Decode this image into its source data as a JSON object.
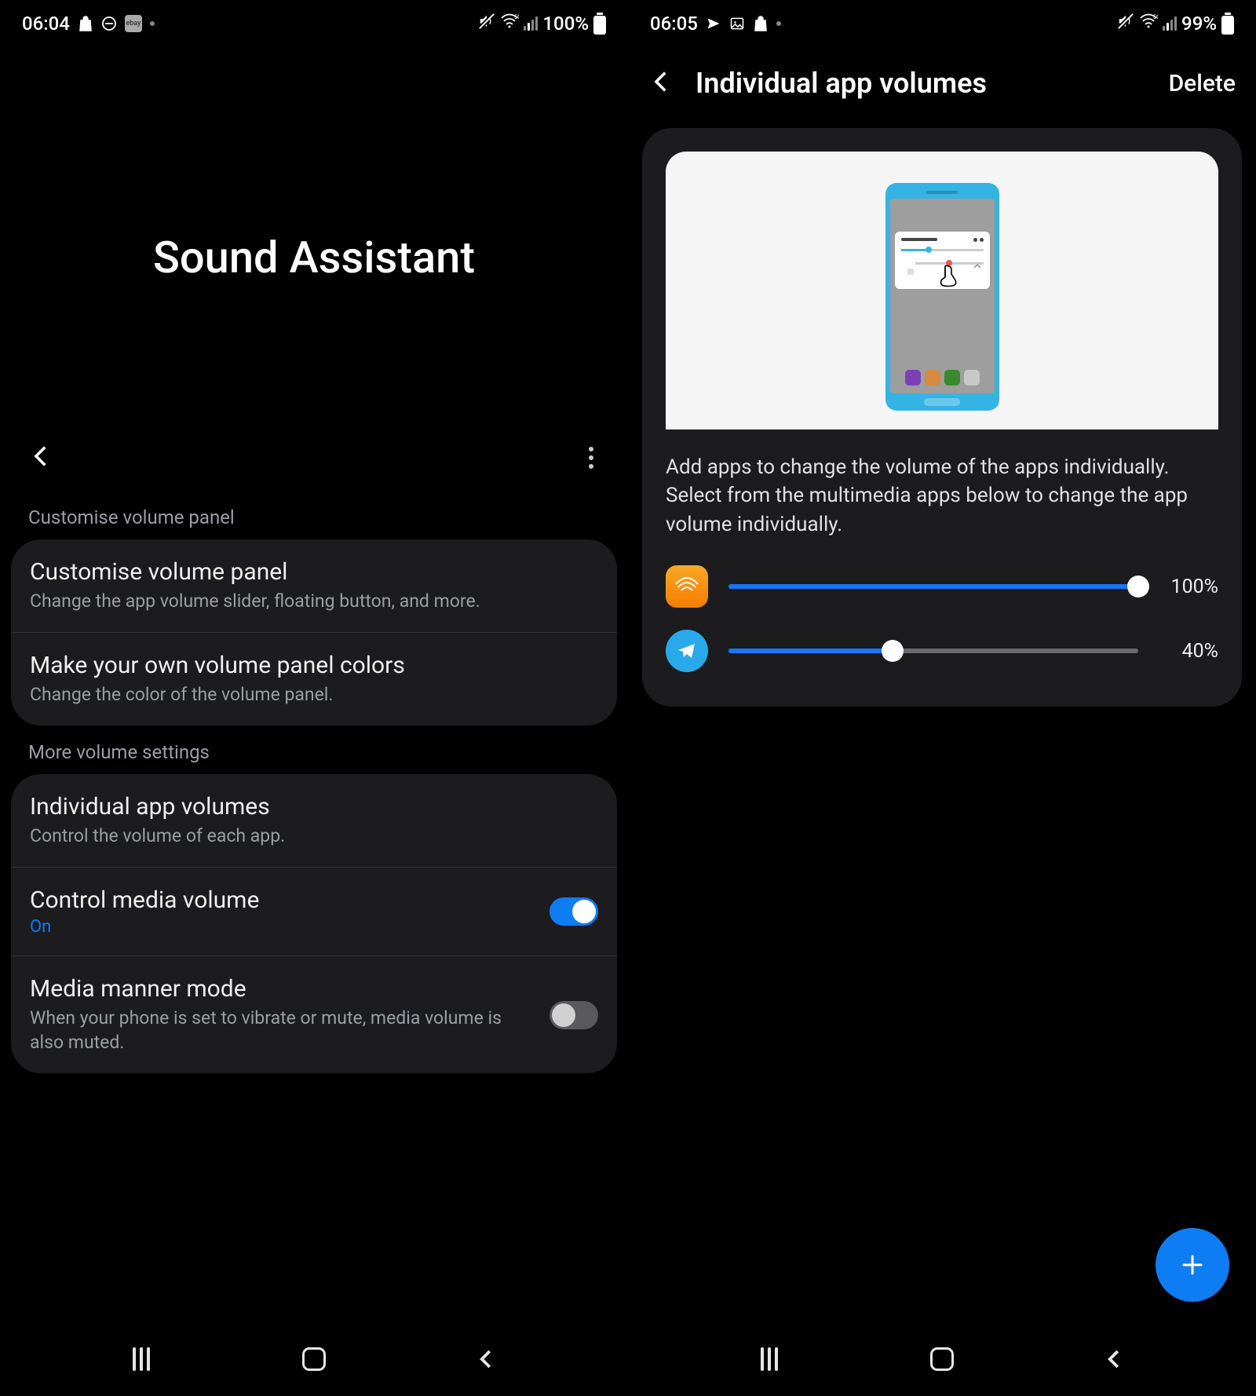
{
  "left": {
    "status": {
      "time": "06:04",
      "battery": "100%"
    },
    "title": "Sound Assistant",
    "section1": {
      "label": "Customise volume panel",
      "items": [
        {
          "title": "Customise volume panel",
          "desc": "Change the app volume slider, floating button, and more."
        },
        {
          "title": "Make your own volume panel colors",
          "desc": "Change the color of the volume panel."
        }
      ]
    },
    "section2": {
      "label": "More volume settings",
      "items": [
        {
          "title": "Individual app volumes",
          "desc": "Control the volume of each app."
        },
        {
          "title": "Control media volume",
          "status": "On",
          "toggle": true
        },
        {
          "title": "Media manner mode",
          "desc": "When your phone is set to vibrate or mute, media volume is also muted.",
          "toggle": false
        }
      ]
    }
  },
  "right": {
    "status": {
      "time": "06:05",
      "battery": "99%"
    },
    "header": {
      "title": "Individual app volumes",
      "action": "Delete"
    },
    "description": "Add apps to change the volume of the apps individually. Select from the multimedia apps below to change the app volume individually.",
    "apps": [
      {
        "name": "audible",
        "percent": 100,
        "label": "100%"
      },
      {
        "name": "telegram",
        "percent": 40,
        "label": "40%"
      }
    ]
  }
}
